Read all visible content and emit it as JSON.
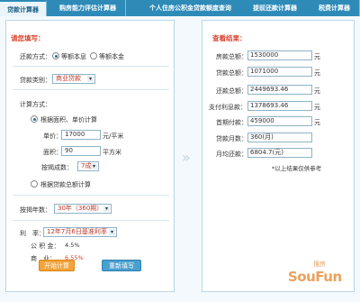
{
  "tabs": [
    {
      "label": "贷款计算器",
      "active": true
    },
    {
      "label": "购房能力评估计算器",
      "active": false
    },
    {
      "label": "个人住房公积金贷款额度查询",
      "active": false
    },
    {
      "label": "提前还款计算器",
      "active": false
    },
    {
      "label": "税费计算器",
      "active": false
    }
  ],
  "left": {
    "title": "请您填写：",
    "repay_method_label": "还款方式：",
    "repay_options": [
      "等额本息",
      "等额本金"
    ],
    "loan_type_label": "贷款类别：",
    "loan_type_value": "商业贷款",
    "calc_method_label": "计算方式：",
    "calc_option_1": "根据面积、单价计算",
    "unit_price_label": "单价：",
    "unit_price_value": "17000",
    "unit_price_unit": "元/平米",
    "area_label": "面积：",
    "area_value": "90",
    "area_unit": "平方米",
    "down_ratio_label": "按揭成数：",
    "down_ratio_value": "7成",
    "calc_option_2": "根据贷款总额计算",
    "years_label": "按揭年数：",
    "years_value": "30年（360期）",
    "rate_label": "利　率：",
    "rate_value": "12年7月6日基准利率",
    "fund_label": "公 积 金：",
    "fund_value": "4.5%",
    "commercial_label": "商　业：",
    "commercial_value": "6.55%",
    "btn_start": "开始计算",
    "btn_reset": "重新填写"
  },
  "right": {
    "title": "查看结果：",
    "results": [
      {
        "label": "房款总额：",
        "value": "1530000",
        "unit": "元"
      },
      {
        "label": "贷款总额：",
        "value": "1071000",
        "unit": "元"
      },
      {
        "label": "还款总额：",
        "value": "2449693.46",
        "unit": "元"
      },
      {
        "label": "支付利息款：",
        "value": "1378693.46",
        "unit": "元"
      },
      {
        "label": "首期付款：",
        "value": "459000",
        "unit": "元"
      },
      {
        "label": "贷款月数：",
        "value": "360(月)",
        "unit": ""
      },
      {
        "label": "月均还款：",
        "value": "6804.7(元)",
        "unit": ""
      }
    ],
    "note": "*以上结果仅供参考"
  },
  "watermark": {
    "main": "SouFun",
    "sub": "搜房"
  }
}
